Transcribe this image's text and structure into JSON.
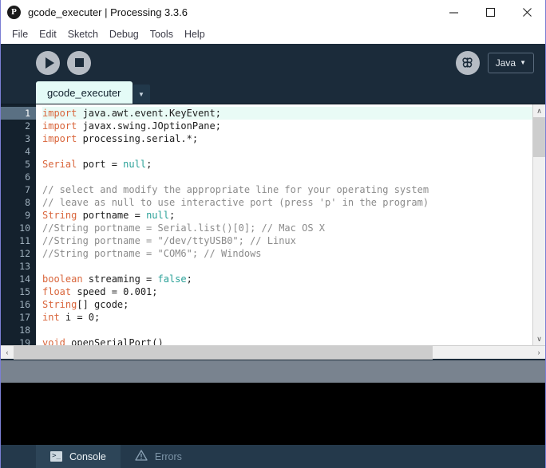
{
  "window": {
    "app_icon": "processing-logo-icon",
    "title": "gcode_executer | Processing 3.3.6",
    "minimize_label": "minimize-icon",
    "maximize_label": "maximize-icon",
    "close_label": "close-icon"
  },
  "menubar": {
    "items": [
      {
        "label": "File"
      },
      {
        "label": "Edit"
      },
      {
        "label": "Sketch"
      },
      {
        "label": "Debug"
      },
      {
        "label": "Tools"
      },
      {
        "label": "Help"
      }
    ]
  },
  "toolbar": {
    "run_label": "Run",
    "stop_label": "Stop",
    "debug_label": "Debugger",
    "mode_label": "Java",
    "mode_caret": "▼"
  },
  "tabs": {
    "sketch_tab_label": "gcode_executer",
    "tab_menu_caret": "▼"
  },
  "editor": {
    "active_line": 1,
    "line_numbers": [
      "1",
      "2",
      "3",
      "4",
      "5",
      "6",
      "7",
      "8",
      "9",
      "10",
      "11",
      "12",
      "13",
      "14",
      "15",
      "16",
      "17",
      "18",
      "19"
    ],
    "lines": [
      {
        "n": 1,
        "text": "import java.awt.event.KeyEvent;"
      },
      {
        "n": 2,
        "text": "import javax.swing.JOptionPane;"
      },
      {
        "n": 3,
        "text": "import processing.serial.*;"
      },
      {
        "n": 4,
        "text": ""
      },
      {
        "n": 5,
        "text": "Serial port = null;"
      },
      {
        "n": 6,
        "text": ""
      },
      {
        "n": 7,
        "text": "// select and modify the appropriate line for your operating system"
      },
      {
        "n": 8,
        "text": "// leave as null to use interactive port (press 'p' in the program)"
      },
      {
        "n": 9,
        "text": "String portname = null;"
      },
      {
        "n": 10,
        "text": "//String portname = Serial.list()[0]; // Mac OS X"
      },
      {
        "n": 11,
        "text": "//String portname = \"/dev/ttyUSB0\"; // Linux"
      },
      {
        "n": 12,
        "text": "//String portname = \"COM6\"; // Windows"
      },
      {
        "n": 13,
        "text": ""
      },
      {
        "n": 14,
        "text": "boolean streaming = false;"
      },
      {
        "n": 15,
        "text": "float speed = 0.001;"
      },
      {
        "n": 16,
        "text": "String[] gcode;"
      },
      {
        "n": 17,
        "text": "int i = 0;"
      },
      {
        "n": 18,
        "text": ""
      },
      {
        "n": 19,
        "text": "void openSerialPort()"
      }
    ],
    "vscroll_up": "∧",
    "vscroll_down": "∨",
    "hscroll_left": "‹",
    "hscroll_right": "›"
  },
  "bottom_tabs": {
    "console_label": "Console",
    "console_icon_glyph": ">_",
    "errors_label": "Errors"
  },
  "colors": {
    "chrome": "#1b2b3a",
    "editor_bg": "#ffffff",
    "gutter_bg": "#14212d",
    "active_line": "#e9fbf6",
    "keyword": "#d9653b",
    "literal": "#2aa198",
    "comment": "#8b8b8b",
    "tab_bg": "#e4fbf7",
    "statusbar": "#79838f",
    "console_bg": "#000000"
  }
}
